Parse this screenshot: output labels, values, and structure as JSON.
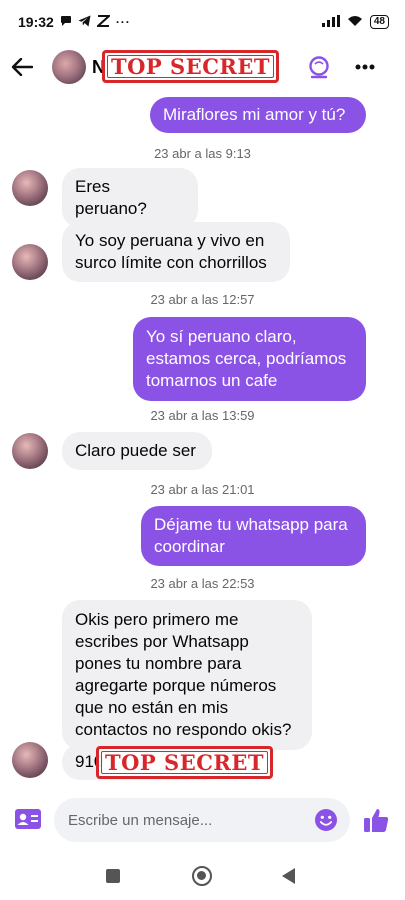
{
  "status_bar": {
    "time": "19:32",
    "battery": "48"
  },
  "header": {
    "contact_name_visible": "N",
    "redaction_stamp": "TOP SECRET"
  },
  "messages": {
    "out_1": "Miraflores mi amor y tú?",
    "ts_1": "23 abr a las 9:13",
    "in_1": "Eres peruano?",
    "in_2": "Yo soy peruana y vivo en surco límite con chorrillos",
    "ts_2": "23 abr a las 12:57",
    "out_2": "Yo sí peruano claro, estamos cerca, podríamos tomarnos un cafe",
    "ts_3": "23 abr a las 13:59",
    "in_3": "Claro puede ser",
    "ts_4": "23 abr a las 21:01",
    "out_3": "Déjame tu whatsapp para coordinar",
    "ts_5": "23 abr a las 22:53",
    "in_4": "Okis pero primero me escribes por Whatsapp pones tu nombre para agregarte porque números que no están en mis contactos no respondo okis?",
    "in_5_visible": "910",
    "in_5_redaction_stamp": "TOP SECRET"
  },
  "composer": {
    "placeholder": "Escribe un mensaje..."
  },
  "colors": {
    "accent": "#8b52e6",
    "incoming_bubble": "#f0f0f3",
    "stamp": "#d8272b"
  }
}
